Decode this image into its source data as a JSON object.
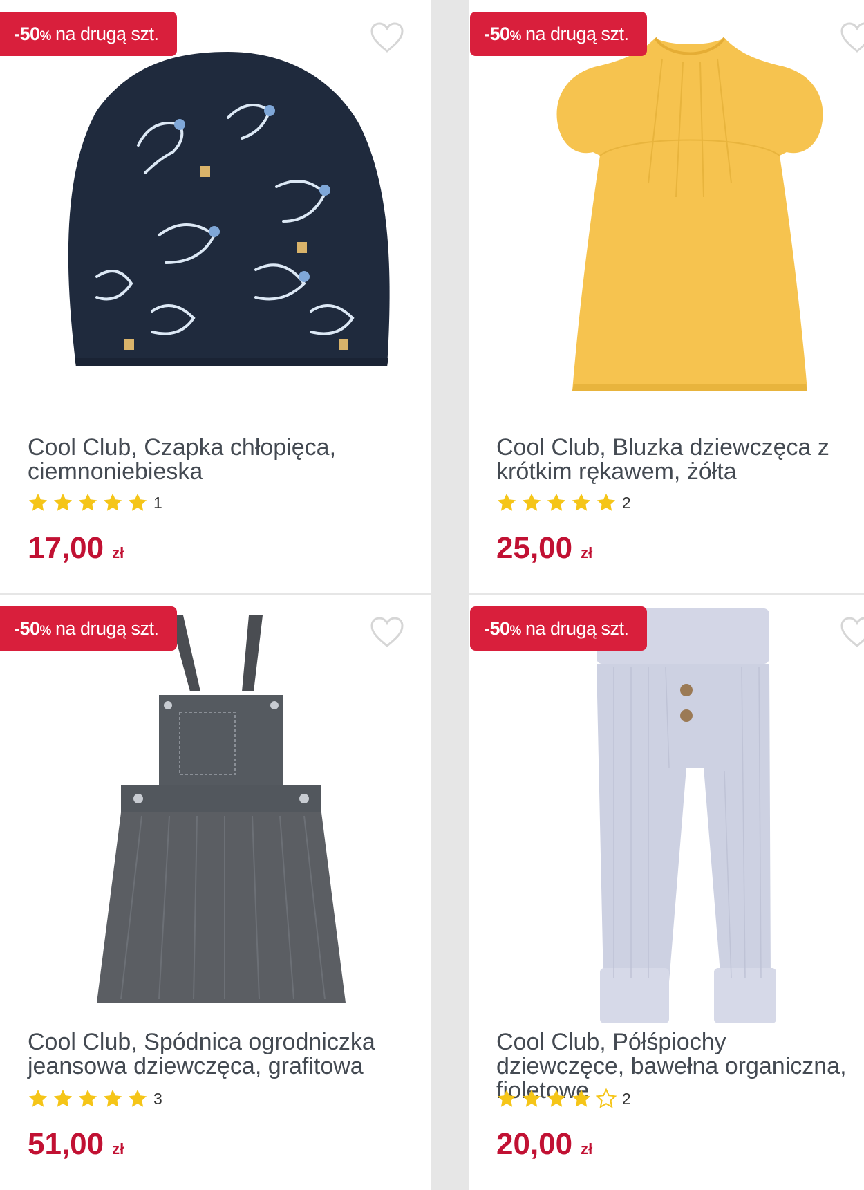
{
  "products": [
    {
      "promo_pct": "-50",
      "promo_pct_sign": "%",
      "promo_text": "na drugą szt.",
      "title": "Cool Club, Czapka chłopięca, ciemnoniebieska",
      "rating_value": 5,
      "rating_count": "1",
      "price": "17,00",
      "currency": "zł",
      "image_icon": "beanie-hat-image"
    },
    {
      "promo_pct": "-50",
      "promo_pct_sign": "%",
      "promo_text": "na drugą szt.",
      "title": "Cool Club, Bluzka dziewczęca z krótkim rękawem, żółta",
      "rating_value": 5,
      "rating_count": "2",
      "price": "25,00",
      "currency": "zł",
      "image_icon": "yellow-blouse-image"
    },
    {
      "promo_pct": "-50",
      "promo_pct_sign": "%",
      "promo_text": "na drugą szt.",
      "title": "Cool Club, Spódnica ogrodniczka jeansowa dziewczęca, grafitowa",
      "rating_value": 5,
      "rating_count": "3",
      "price": "51,00",
      "currency": "zł",
      "image_icon": "overall-skirt-image"
    },
    {
      "promo_pct": "-50",
      "promo_pct_sign": "%",
      "promo_text": "na drugą szt.",
      "title": "Cool Club, Półśpiochy dziewczęce, bawełna organiczna, fioletowe",
      "rating_value": 4,
      "rating_count": "2",
      "price": "20,00",
      "currency": "zł",
      "image_icon": "lilac-leggings-image"
    }
  ],
  "colors": {
    "promo": "#d91f3c",
    "price": "#c11133",
    "star": "#f5c518",
    "title": "#444a52"
  }
}
